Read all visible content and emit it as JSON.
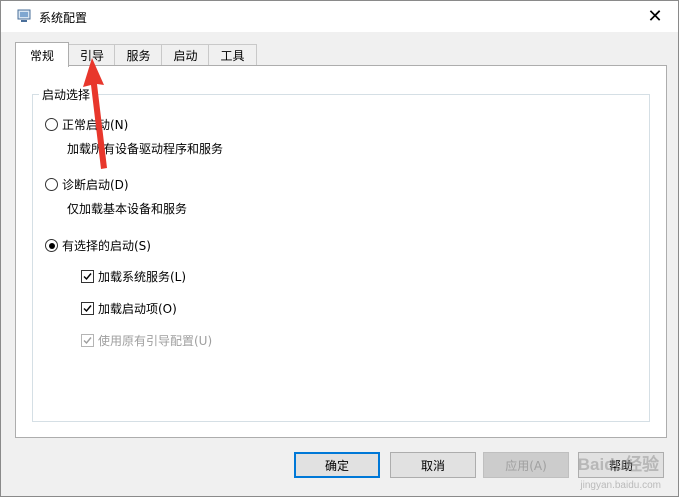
{
  "window": {
    "title": "系统配置",
    "close_glyph": "✕"
  },
  "tabs": [
    {
      "label": "常规",
      "active": true
    },
    {
      "label": "引导",
      "active": false
    },
    {
      "label": "服务",
      "active": false
    },
    {
      "label": "启动",
      "active": false
    },
    {
      "label": "工具",
      "active": false
    }
  ],
  "startup": {
    "group_label": "启动选择",
    "options": [
      {
        "label": "正常启动(N)",
        "desc": "加载所有设备驱动程序和服务",
        "checked": false
      },
      {
        "label": "诊断启动(D)",
        "desc": "仅加载基本设备和服务",
        "checked": false
      },
      {
        "label": "有选择的启动(S)",
        "desc": "",
        "checked": true
      }
    ],
    "selective": [
      {
        "label": "加载系统服务(L)",
        "checked": true,
        "disabled": false
      },
      {
        "label": "加载启动项(O)",
        "checked": true,
        "disabled": false
      },
      {
        "label": "使用原有引导配置(U)",
        "checked": true,
        "disabled": true
      }
    ]
  },
  "buttons": {
    "ok": "确定",
    "cancel": "取消",
    "apply": "应用(A)",
    "help": "帮助"
  },
  "watermark": {
    "brand": "Baidu经验",
    "url": "jingyan.baidu.com"
  },
  "colors": {
    "accent": "#0078d7",
    "annotation_arrow": "#e8372c"
  }
}
